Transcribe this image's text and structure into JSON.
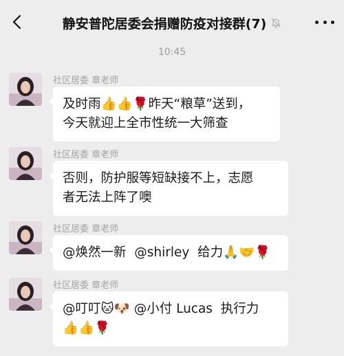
{
  "header": {
    "back_icon": "chevron-left-icon",
    "title": "静安普陀居委会捐赠防疫对接群(7)",
    "mute_icon": "bell-off-icon",
    "more_icon": "more-dots-icon"
  },
  "timestamp": "10:45",
  "messages": [
    {
      "sender": "社区居委 章老师",
      "lines": [
        "及时雨👍👍🌹昨天“粮草”送到，",
        "今天就迎上全市性统一大筛查"
      ]
    },
    {
      "sender": "社区居委 章老师",
      "lines": [
        "否则，防护服等短缺接不上，志愿",
        "者无法上阵了噢"
      ]
    },
    {
      "sender": "社区居委 章老师",
      "lines": [
        "@焕然一新  @shirley  给力🙏🤝🌹"
      ]
    },
    {
      "sender": "社区居委 章老师",
      "lines": [
        "@叮叮🐱🐶 @小付 Lucas  执行力",
        "👍👍🌹"
      ]
    }
  ],
  "colors": {
    "background": "#ededed",
    "bubble": "#ffffff",
    "sender_text": "#a3a3a3",
    "timestamp_text": "#9a9a9a"
  }
}
